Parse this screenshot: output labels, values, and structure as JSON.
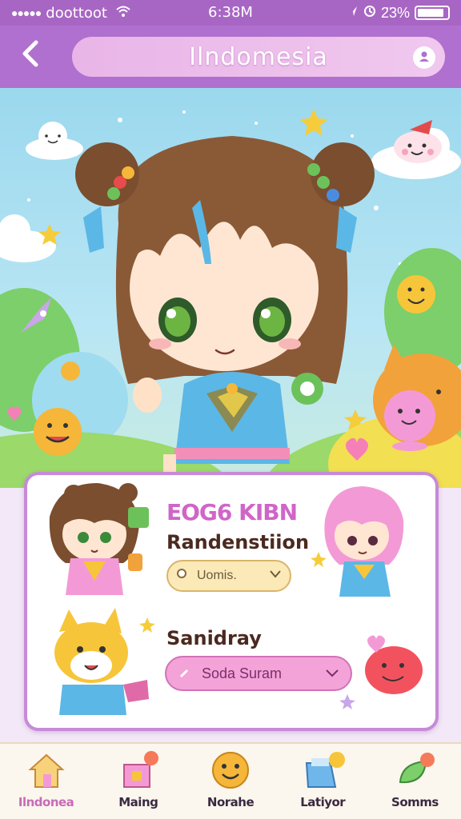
{
  "status_bar": {
    "signal": "●●●●●",
    "carrier": "doottoot",
    "time": "6:38M",
    "battery": "2̈3%",
    "battery_level": 0.9
  },
  "header": {
    "title": "Ilndomesia",
    "back_icon": "chevron-left-icon",
    "profile_icon": "user-circle-icon"
  },
  "card": {
    "name": "EOG6 KIBN",
    "subtitle": "Randenstiion",
    "select_1": "Uomis.",
    "subtitle_2": "Sanidray",
    "select_2": "Soda  Suram"
  },
  "tabs": [
    {
      "label": "Ilndonea",
      "icon": "house-icon",
      "active": true
    },
    {
      "label": "Maing",
      "icon": "gift-box-icon",
      "active": false
    },
    {
      "label": "Norahe",
      "icon": "smiley-icon",
      "active": false
    },
    {
      "label": "Latiyor",
      "icon": "folder-box-icon",
      "active": false
    },
    {
      "label": "Somms",
      "icon": "leaf-icon",
      "active": false
    }
  ],
  "colors": {
    "accent": "#b070cf",
    "pink": "#d065c8",
    "card_border": "#c78ad8"
  }
}
